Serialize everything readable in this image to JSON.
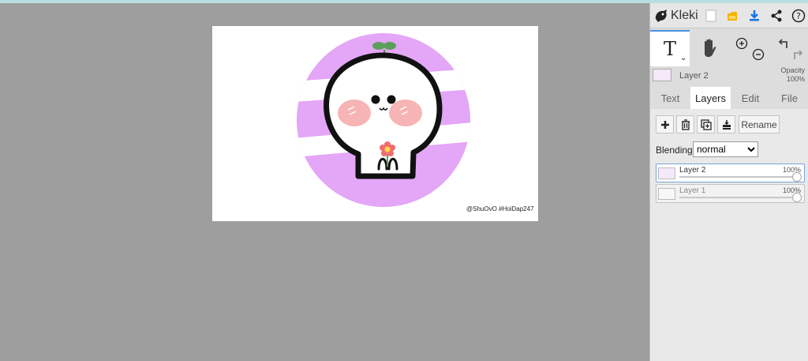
{
  "app": {
    "name": "Kleki"
  },
  "toolbar_icons": [
    "new-image-icon",
    "save-icon",
    "download-icon",
    "share-icon",
    "help-icon"
  ],
  "tools": {
    "text_glyph": "T",
    "text_caret": "⌄",
    "hand": "hand-icon",
    "zoom_in": "zoom-in-icon",
    "zoom_out": "zoom-out-icon",
    "undo": "undo-icon",
    "redo": "redo-icon"
  },
  "current_layer": {
    "name": "Layer 2",
    "opacity_label": "Opacity",
    "opacity_value": "100%"
  },
  "tabs": [
    {
      "label": "Text",
      "active": false
    },
    {
      "label": "Layers",
      "active": true
    },
    {
      "label": "Edit",
      "active": false
    },
    {
      "label": "File",
      "active": false
    }
  ],
  "layer_panel": {
    "buttons": [
      "add-layer-icon",
      "delete-layer-icon",
      "duplicate-layer-icon",
      "merge-down-icon"
    ],
    "rename_label": "Rename",
    "blending_label": "Blending",
    "blending_value": "normal",
    "layers": [
      {
        "name": "Layer 2",
        "opacity": "100%",
        "active": true
      },
      {
        "name": "Layer 1",
        "opacity": "100%",
        "active": false
      }
    ]
  },
  "canvas": {
    "watermark": "@ShuOvO #HoiDap247"
  },
  "colors": {
    "workspace": "#9e9e9e",
    "accent": "#1a73e8",
    "lilac": "#e4a6f6",
    "blush": "#f7b4b4",
    "sprout": "#5aa05a",
    "flower": "#f06d6d"
  }
}
